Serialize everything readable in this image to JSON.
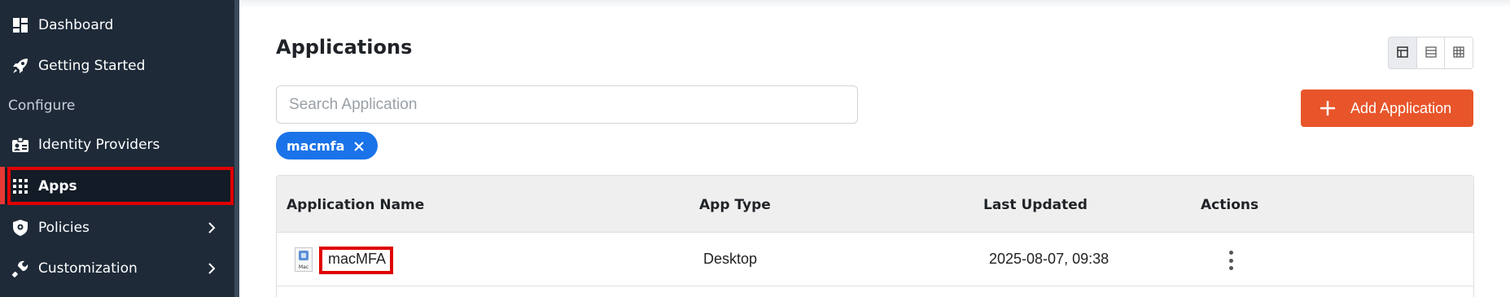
{
  "sidebar": {
    "items": [
      {
        "label": "Dashboard",
        "icon": "dashboard-icon"
      },
      {
        "label": "Getting Started",
        "icon": "rocket-icon"
      },
      {
        "label": "Identity Providers",
        "icon": "id-badge-icon"
      },
      {
        "label": "Apps",
        "icon": "grid-icon"
      },
      {
        "label": "Policies",
        "icon": "shield-icon"
      },
      {
        "label": "Customization",
        "icon": "wrench-icon"
      }
    ],
    "section_label": "Configure",
    "active_item": "Apps"
  },
  "main": {
    "title": "Applications",
    "search": {
      "placeholder": "Search Application",
      "value": ""
    },
    "add_button_label": "Add Application",
    "filter_chip": "macmfa",
    "view_modes": [
      "table-view-icon",
      "list-view-icon",
      "grid-view-icon"
    ],
    "selected_view": "table-view-icon",
    "table": {
      "headers": [
        "Application Name",
        "App Type",
        "Last Updated",
        "Actions"
      ],
      "rows": [
        {
          "icon_label": "Mac",
          "name": "macMFA",
          "type": "Desktop",
          "updated": "2025-08-07, 09:38"
        }
      ]
    }
  },
  "colors": {
    "sidebar_bg": "#1e2a38",
    "accent_orange": "#e8552a",
    "chip_blue": "#1a73e8",
    "highlight_red": "#e00000"
  }
}
